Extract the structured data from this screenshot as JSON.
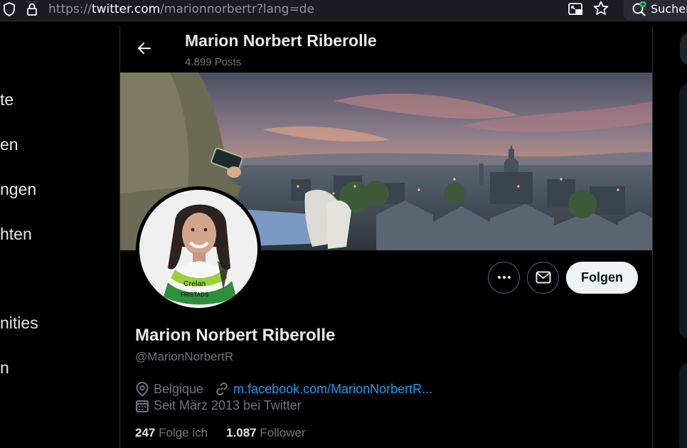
{
  "browser": {
    "url_prefix": "https://",
    "url_host": "twitter.com",
    "url_path": "/marionnorbertr?lang=de",
    "search_label": "Suchen"
  },
  "nav": {
    "items": [
      {
        "label": "te"
      },
      {
        "label": "en"
      },
      {
        "label": "ngen"
      },
      {
        "label": "hten"
      },
      {
        "label": "nities"
      },
      {
        "label": "n"
      }
    ]
  },
  "header": {
    "title": "Marion Norbert Riberolle",
    "posts_count": "4.899 Posts"
  },
  "profile": {
    "name": "Marion Norbert Riberolle",
    "handle": "@MarionNorbertR",
    "location": "Belgique",
    "website": "m.facebook.com/MarionNorbertR...",
    "joined": "Seit März 2013 bei Twitter",
    "following_count": "247",
    "following_label": "Folge ich",
    "followers_count": "1.087",
    "followers_label": "Follower",
    "follow_button": "Folgen",
    "jersey_text_1": "Crelan",
    "jersey_text_2": "FRISTADS"
  },
  "colors": {
    "accent": "#1d9bf0",
    "background": "#000000",
    "muted": "#71767b"
  }
}
